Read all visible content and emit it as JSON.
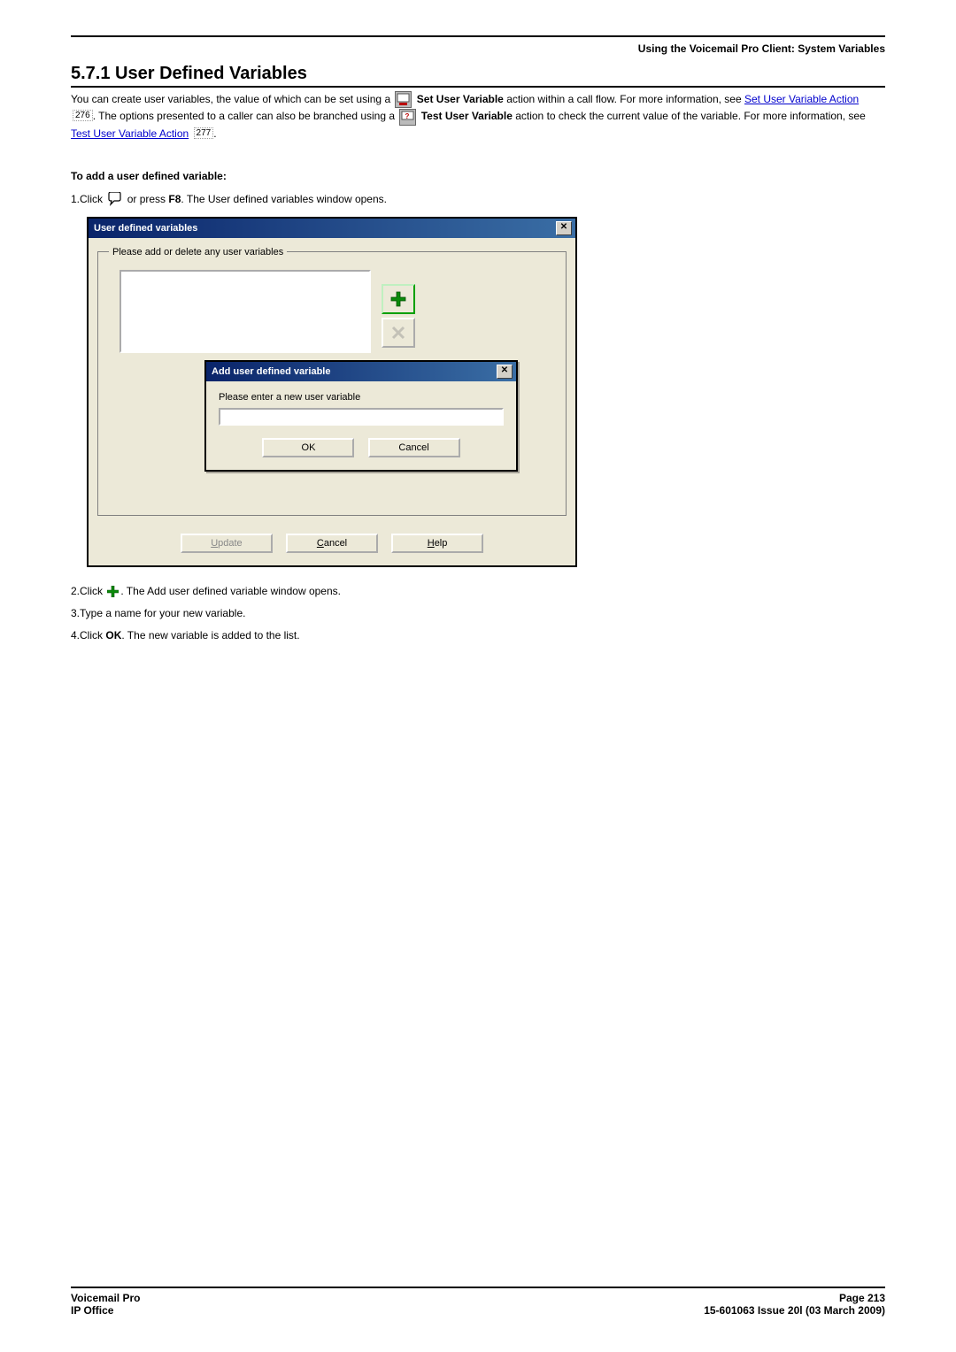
{
  "header": {
    "breadcrumb": "Using the Voicemail Pro Client: System Variables"
  },
  "section": {
    "number": "5.7.1",
    "title": "User Defined Variables"
  },
  "intro": {
    "part1": "You can create user variables, the value of which can be set using a ",
    "set_var_bold": " Set User Variable",
    "part2": " action within a call flow. For more information, see ",
    "link1_text": "Set User Variable Action",
    "ref1": "276",
    "part3": ". The options presented to a caller can also be branched using a ",
    "test_var_bold": "Test User Variable",
    "part4": " action to check the current value of the variable. For more information, see ",
    "link2_text": "Test User Variable Action",
    "ref2": "277",
    "part5": "."
  },
  "procedure": {
    "heading": "To add a user defined variable",
    "step1_a": "Click ",
    "step1_b": " or press ",
    "step1_key": "F8",
    "step1_c": ". The User defined variables window opens.",
    "step2_a": "Click ",
    "step2_b": ". The Add user defined variable window opens.",
    "step3": "Type a name for your new variable.",
    "step4_a": "Click ",
    "step4_ok": "OK",
    "step4_b": ". The new variable is added to the list."
  },
  "dialog1": {
    "title": "User defined variables",
    "group_legend": "Please add or delete any user variables",
    "update": "Update",
    "cancel": "Cancel",
    "help": "Help"
  },
  "dialog2": {
    "title": "Add user defined variable",
    "prompt": "Please enter a new user variable",
    "ok": "OK",
    "cancel": "Cancel"
  },
  "footer": {
    "left1": "Voicemail Pro",
    "left2": "IP Office",
    "right1": "Page 213",
    "right2": "15-601063 Issue 20l (03 March 2009)"
  }
}
